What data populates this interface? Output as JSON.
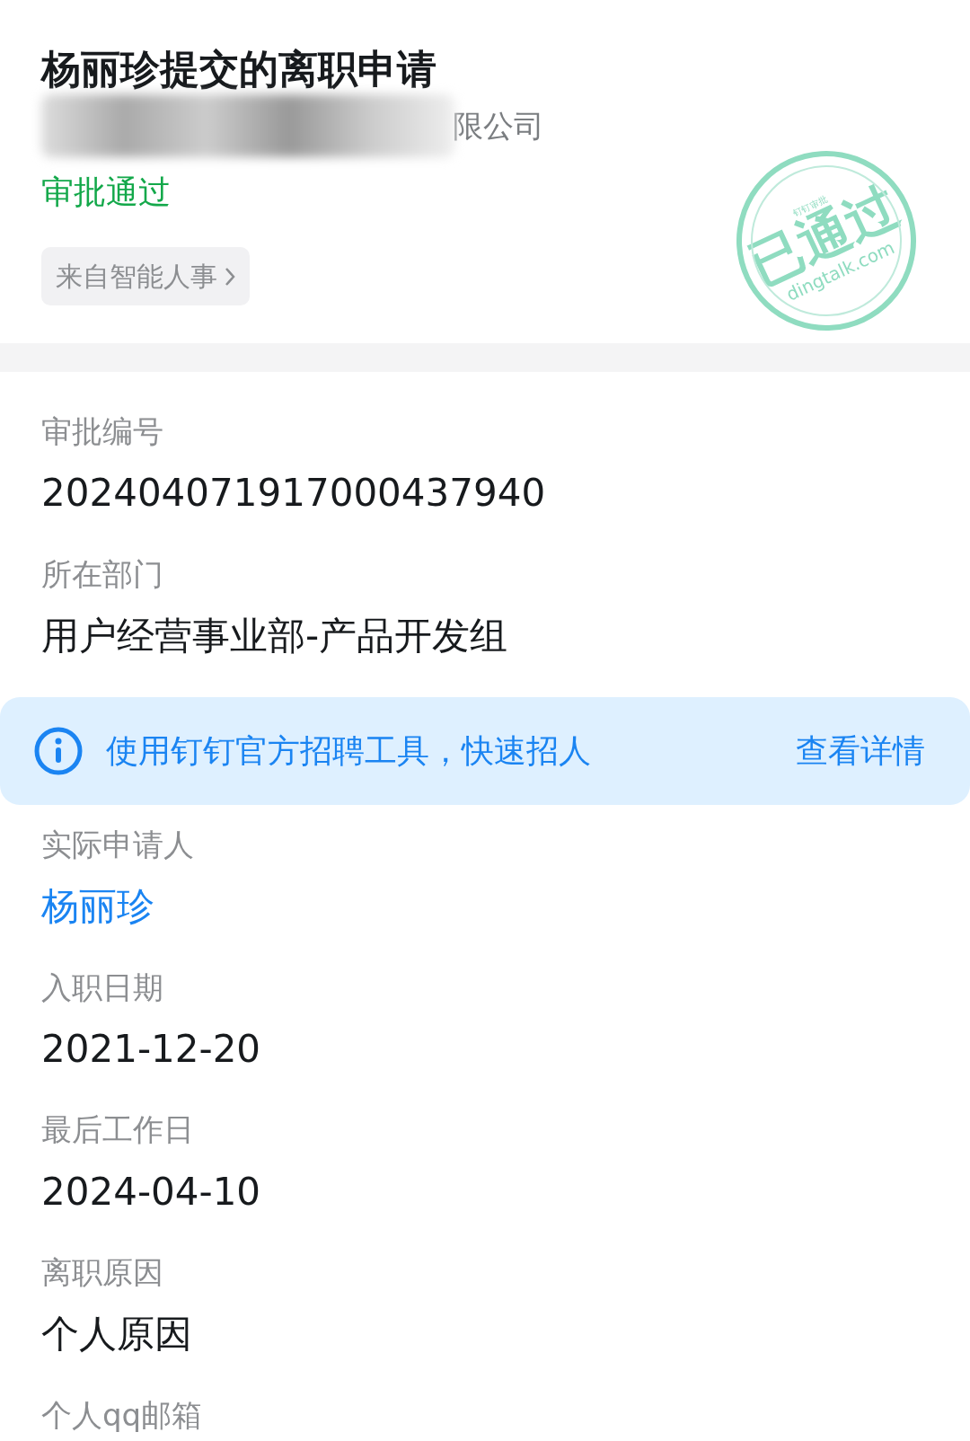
{
  "header": {
    "title": "杨丽珍提交的离职申请",
    "company": "限公司",
    "status": "审批通过",
    "source_tag": "来自智能人事",
    "stamp": {
      "caption": "钉钉审批",
      "text": "已通过",
      "domain": "dingtalk.com"
    }
  },
  "items": [
    {
      "kind": "field",
      "label": "审批编号",
      "value": "202404071917000437940",
      "link": false
    },
    {
      "kind": "field",
      "label": "所在部门",
      "value": "用户经营事业部-产品开发组",
      "link": false
    },
    {
      "kind": "banner",
      "text": "使用钉钉官方招聘工具，快速招人",
      "action": "查看详情"
    },
    {
      "kind": "field",
      "label": "实际申请人",
      "value": "杨丽珍",
      "link": true
    },
    {
      "kind": "field",
      "label": "入职日期",
      "value": "2021-12-20",
      "link": false
    },
    {
      "kind": "field",
      "label": "最后工作日",
      "value": "2024-04-10",
      "link": false
    },
    {
      "kind": "field",
      "label": "离职原因",
      "value": "个人原因",
      "link": false
    },
    {
      "kind": "field",
      "label": "个人qq邮箱"
    }
  ]
}
